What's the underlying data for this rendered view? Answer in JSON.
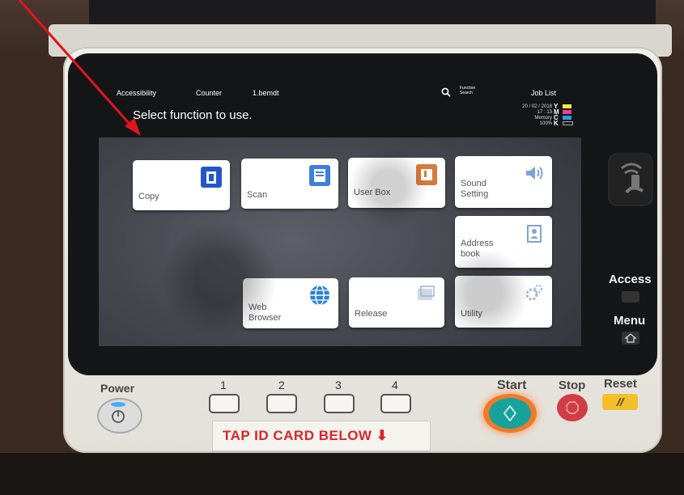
{
  "screen": {
    "topbar": {
      "accessibility": "Accessibility",
      "counter": "Counter",
      "user": "1.bemdt",
      "function_search": "Function Search",
      "job_list": "Job List"
    },
    "title": "Select function to use.",
    "status": {
      "date": "20 / 02 / 2018",
      "time": "17 : 13",
      "memory_label": "Memory",
      "memory_value": "100%"
    },
    "toner": [
      {
        "letter": "Y",
        "color": "#f7e93a"
      },
      {
        "letter": "M",
        "color": "#ea3d9c"
      },
      {
        "letter": "C",
        "color": "#2f9ae6"
      },
      {
        "letter": "K",
        "color": "#1a1a1a"
      }
    ],
    "tiles": {
      "copy": "Copy",
      "scan": "Scan",
      "user_box": "User Box",
      "sound_setting_1": "Sound",
      "sound_setting_2": "Setting",
      "address_book_1": "Address",
      "address_book_2": "book",
      "web_browser_1": "Web",
      "web_browser_2": "Browser",
      "release": "Release",
      "utility": "Utility"
    }
  },
  "hardware": {
    "power": "Power",
    "keys": [
      "1",
      "2",
      "3",
      "4"
    ],
    "start": "Start",
    "stop": "Stop",
    "reset": "Reset",
    "access": "Access",
    "menu": "Menu",
    "tap_banner": "TAP ID CARD BELOW ⬇"
  },
  "colors": {
    "annotation_arrow": "#e0151c",
    "start_ring": "#f07a2a",
    "start_button": "#17a39b",
    "stop_button": "#d23c44",
    "reset_button": "#f2c02a",
    "power_led": "#4aa8ff"
  }
}
